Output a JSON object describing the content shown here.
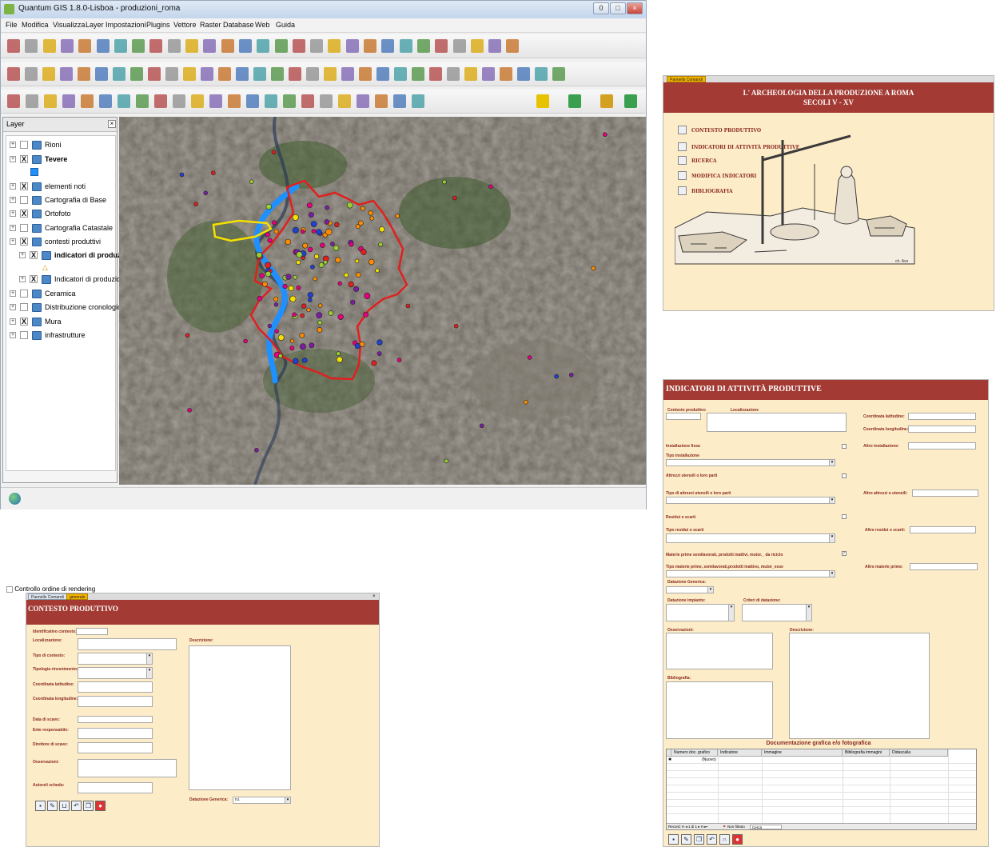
{
  "qgis": {
    "title": "Quantum GIS 1.8.0-Lisboa - produzioni_roma",
    "window_buttons": [
      "0",
      "□",
      "×"
    ],
    "menu": [
      "File",
      "Modifica",
      "Visualizza",
      "Layer",
      "Impostazioni",
      "Plugins",
      "Vettore",
      "Raster",
      "Database",
      "Web",
      "Guida"
    ],
    "layer_panel": {
      "title": "Layer",
      "close_symbol": "×",
      "layers": [
        {
          "name": "Rioni",
          "checked": ""
        },
        {
          "name": "Tevere",
          "checked": "X"
        },
        {
          "name": "elementi noti",
          "checked": "X"
        },
        {
          "name": "Cartografia di Base",
          "checked": ""
        },
        {
          "name": "Ortofoto",
          "checked": "X"
        },
        {
          "name": "Cartografia Catastale",
          "checked": ""
        },
        {
          "name": "contesti produttivi",
          "checked": "X"
        },
        {
          "name": "indicatori di produzi...",
          "checked": "X"
        },
        {
          "name": "Indicatori di produzio...",
          "checked": "X"
        },
        {
          "name": "Ceramica",
          "checked": ""
        },
        {
          "name": "Distribuzione cronologica...",
          "checked": ""
        },
        {
          "name": "Mura",
          "checked": "X"
        },
        {
          "name": "infrastrutture",
          "checked": ""
        }
      ],
      "render_order_label": "Controllo ordine di rendering"
    },
    "colors": {
      "boundary": "#e02020",
      "river": "#1e90ff",
      "highlight": "#f5e000"
    }
  },
  "pannello": {
    "tabs": [
      "Pannello Comandi"
    ],
    "title_line1": "L' ARCHEOLOGIA DELLA PRODUZIONE A ROMA",
    "title_line2": "SECOLI V - XV",
    "menu": [
      "CONTESTO PRODUTTIVO",
      "INDICATORI DI ATTIVITÀ PRODUTTIVE",
      "RICERCA",
      "MODIFICA INDICATORI",
      "BIBLIOGRAFIA"
    ],
    "signature": "ch. Avo"
  },
  "indicatori": {
    "title": "INDICATORI DI ATTIVITÀ PRODUTTIVE",
    "labels": {
      "contesto": "Contesto produttivo",
      "localizzazione": "Localizzazione",
      "lat": "Coordinata latitudine:",
      "lon": "Coordinata longitudine:",
      "inst_fissa": "Installazione fissa",
      "altro_inst": "Altro installazione:",
      "tipo_inst": "Tipo installazione",
      "attrezzi": "Attrezzi utensili o loro parti",
      "tipo_attrezzi": "Tipo di attrezzi utensili o loro parti",
      "altro_attrezzi": "Altro attrezzi o utensili:",
      "residui": "Residui o scarti",
      "tipo_residui": "Tipo residui o scarti",
      "altro_residui": "Altro residui o scarti:",
      "materie": "Materie prime semilavorati, prodotti inattivi, mutor._ da riciclo",
      "tipo_materie": "Tipo materie prime, semilavorati,prodotti inattivo, mutor_esse",
      "altro_materie": "Altro materie prime:",
      "dat_generica": "Datazione Generica:",
      "dat_impianto": "Datazione impianto:",
      "criteri": "Criteri di datazione:",
      "osservazioni": "Osservazioni:",
      "descrizione": "Descrizione:",
      "bibliografia": "Bibliografia:"
    },
    "documentazione_title": "Documentazione grafica e/o fotografica",
    "grid_headers": [
      "Numero doc. grafico",
      "Indicatore",
      "Immagine",
      "Bibliografia immagini",
      "Didascalia"
    ],
    "new_row": "(Nuovo)",
    "record_nav": "Record: H  ◂ 1 di 1  ▸ H ▸▪",
    "filter": "Non filtrato",
    "search": "Cerca"
  },
  "contesto": {
    "tabs": [
      "Pannello Comandi",
      "generale"
    ],
    "close_symbol": "×",
    "title": "CONTESTO PRODUTTIVO",
    "labels": {
      "identificativo": "Identificativo contesto:",
      "localizzazione": "Localizzazione:",
      "tipo": "Tipo di contesto:",
      "tipologia": "Tipologia rinvenimento:",
      "lat": "Coordinata latitudine:",
      "lon": "Coordinata longitudine:",
      "data_scavo": "Data di scavo:",
      "ente": "Ente responsabile:",
      "direttore": "Direttore di scavo:",
      "osservazioni": "Osservazioni:",
      "autore": "Autore/i scheda:",
      "descrizione": "Descrizione:",
      "datazione": "Datazione Generica:"
    },
    "datazione_value": "n.i."
  }
}
